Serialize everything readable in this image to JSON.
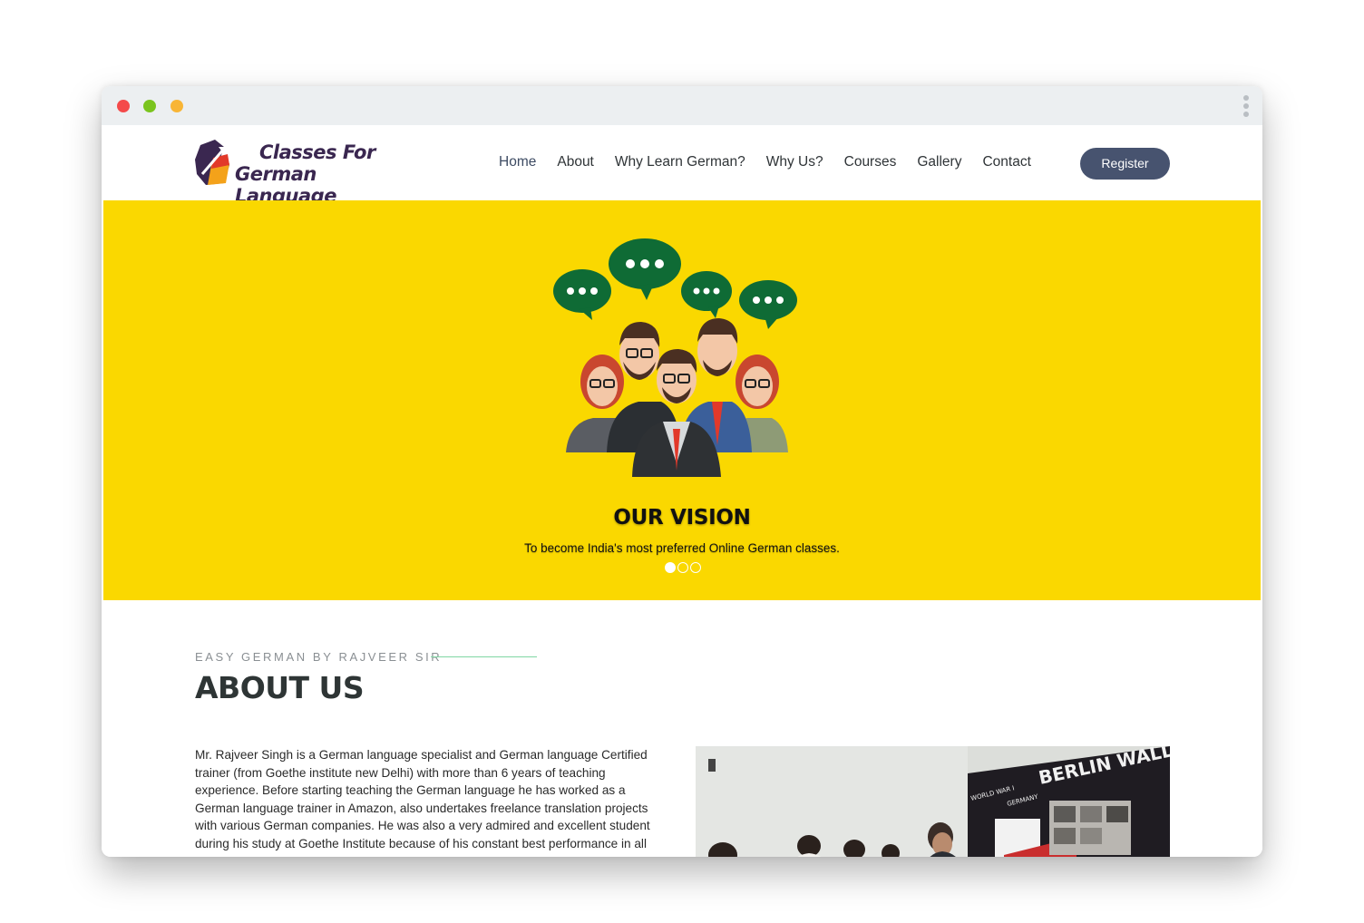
{
  "window": {
    "controls": [
      "close",
      "minimize",
      "zoom"
    ],
    "menu_icon": "kebab-menu-icon"
  },
  "brand": {
    "line1": "Classes For",
    "line2": "German Language"
  },
  "nav": {
    "items": [
      {
        "label": "Home",
        "active": true
      },
      {
        "label": "About"
      },
      {
        "label": "Why Learn German?"
      },
      {
        "label": "Why Us?"
      },
      {
        "label": "Courses"
      },
      {
        "label": "Gallery"
      },
      {
        "label": "Contact"
      }
    ],
    "register_label": "Register"
  },
  "hero": {
    "title": "OUR VISION",
    "subtitle": "To become India's most preferred Online German classes.",
    "slide_count": 3,
    "active_slide": 1
  },
  "about": {
    "eyebrow": "EASY GERMAN BY RAJVEER SIR",
    "title": "ABOUT US",
    "text": "Mr. Rajveer Singh is a German language specialist and German language Certified trainer (from Goethe institute new Delhi) with more than 6 years of teaching experience. Before starting teaching the German language he has worked as a German language trainer in Amazon, also undertakes freelance translation projects with various German companies. He was also a very admired and excellent student during his study at Goethe Institute because of his constant best performance in all"
  },
  "photo": {
    "board_text": "BERLIN WALL",
    "board_left": "WORLD WAR I",
    "board_mid": "GERMANY"
  },
  "colors": {
    "hero_bg": "#fad800",
    "register_bg": "#47536f",
    "bubble": "#0f6b35",
    "eyebrow_line": "#7fd6a3"
  }
}
